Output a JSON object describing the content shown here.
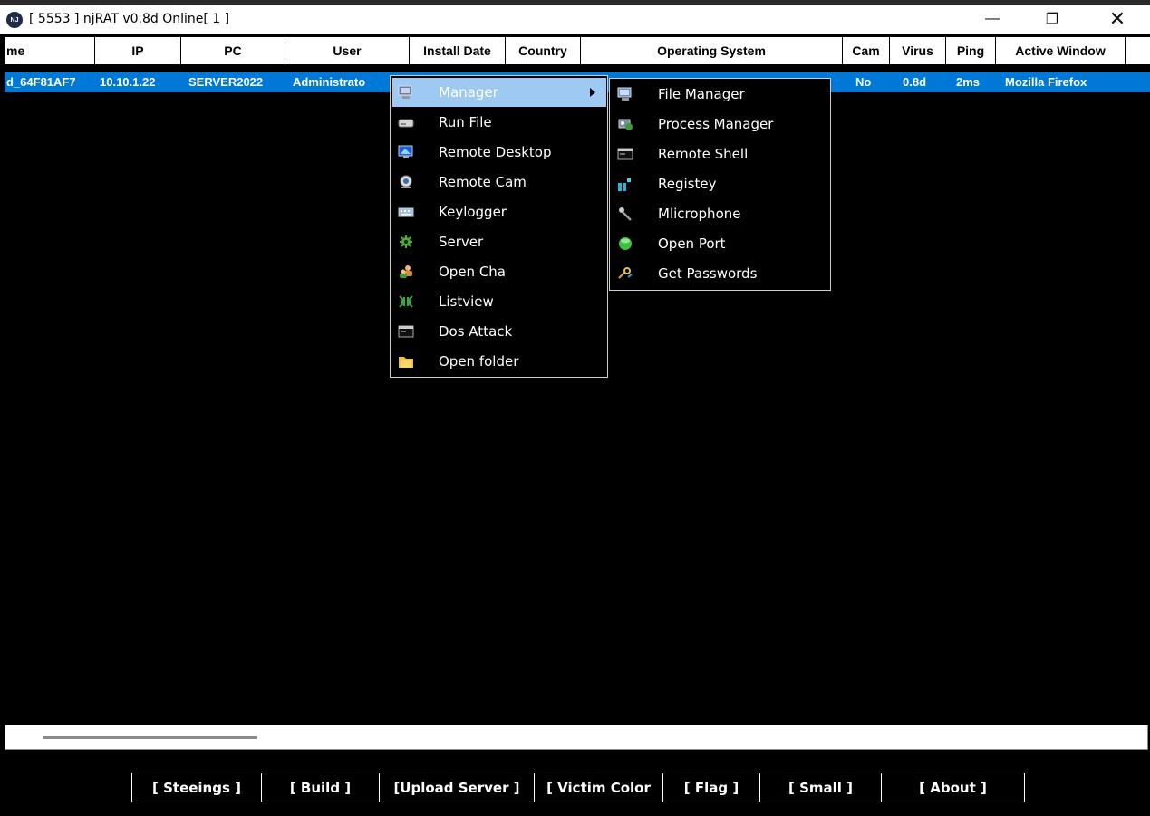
{
  "window": {
    "title": "[ 5553 ] njRAT v0.8d Online[ 1 ]",
    "icon_text": "NJ",
    "minimize": "—",
    "maximize": "❐",
    "close": "✕"
  },
  "columns": [
    "me",
    "IP",
    "PC",
    "User",
    "Install Date",
    "Country",
    "Operating System",
    "Cam",
    "Virus",
    "Ping",
    "Active Window"
  ],
  "row": {
    "name": "d_64F81AF7",
    "ip": "10.10.1.22",
    "pc": "SERVER2022",
    "user": "Administrato",
    "cam": "No",
    "virus": "0.8d",
    "ping": "2ms",
    "active_window": "Mozilla Firefox"
  },
  "context_menu": {
    "items": [
      {
        "label": "Manager",
        "icon": "monitor-icon",
        "highlighted": true,
        "has_submenu": true
      },
      {
        "label": "Run File",
        "icon": "drive-icon"
      },
      {
        "label": "Remote Desktop",
        "icon": "desktop-icon"
      },
      {
        "label": "Remote Cam",
        "icon": "webcam-icon"
      },
      {
        "label": "Keylogger",
        "icon": "keyboard-icon"
      },
      {
        "label": "Server",
        "icon": "gear-icon"
      },
      {
        "label": "Open Cha",
        "icon": "users-icon"
      },
      {
        "label": "Listview",
        "icon": "arrows-icon"
      },
      {
        "label": "Dos Attack",
        "icon": "console-icon"
      },
      {
        "label": "Open folder",
        "icon": "folder-icon"
      }
    ]
  },
  "submenu": {
    "items": [
      {
        "label": "File Manager",
        "icon": "monitor-icon"
      },
      {
        "label": "Process Manager",
        "icon": "process-icon"
      },
      {
        "label": "Remote Shell",
        "icon": "console-icon"
      },
      {
        "label": "Registey",
        "icon": "registry-icon"
      },
      {
        "label": "Mlicrophone",
        "icon": "microphone-icon"
      },
      {
        "label": "Open Port",
        "icon": "green-dot-icon"
      },
      {
        "label": "Get Passwords",
        "icon": "key-icon"
      }
    ]
  },
  "toolbar": {
    "buttons": [
      "[ Steeings ]",
      "[ Build ]",
      "[Upload Server ]",
      "[ Victim Color",
      "[ Flag ]",
      "[ Small ]",
      "[ About ]"
    ]
  },
  "colors": {
    "selection": "#0078d7",
    "menu_highlight": "#9ec9f2",
    "background": "#000000"
  }
}
